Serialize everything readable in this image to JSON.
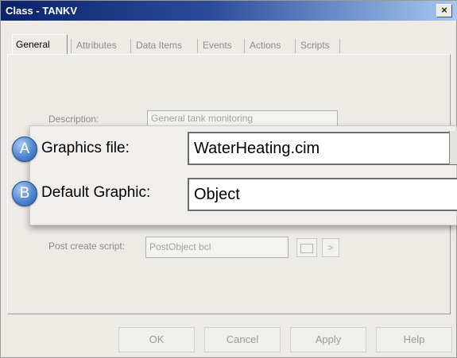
{
  "window": {
    "title": "Class - TANKV",
    "close_glyph": "×"
  },
  "tabs": [
    {
      "label": "General",
      "active": true
    },
    {
      "label": "Attributes"
    },
    {
      "label": "Data Items"
    },
    {
      "label": "Events"
    },
    {
      "label": "Actions"
    },
    {
      "label": "Scripts"
    }
  ],
  "general": {
    "description_label": "Description:",
    "description_value": "General tank monitoring",
    "post_create_label": "Post create script:",
    "post_create_value": "PostObject bcl",
    "arrow_glyph": ">"
  },
  "callout": {
    "badge_a": "A",
    "badge_b": "B",
    "graphics_file_label": "Graphics file:",
    "graphics_file_value": "WaterHeating.cim",
    "default_graphic_label": "Default Graphic:",
    "default_graphic_value": "Object"
  },
  "buttons": {
    "ok": "OK",
    "cancel": "Cancel",
    "apply": "Apply",
    "help": "Help"
  }
}
